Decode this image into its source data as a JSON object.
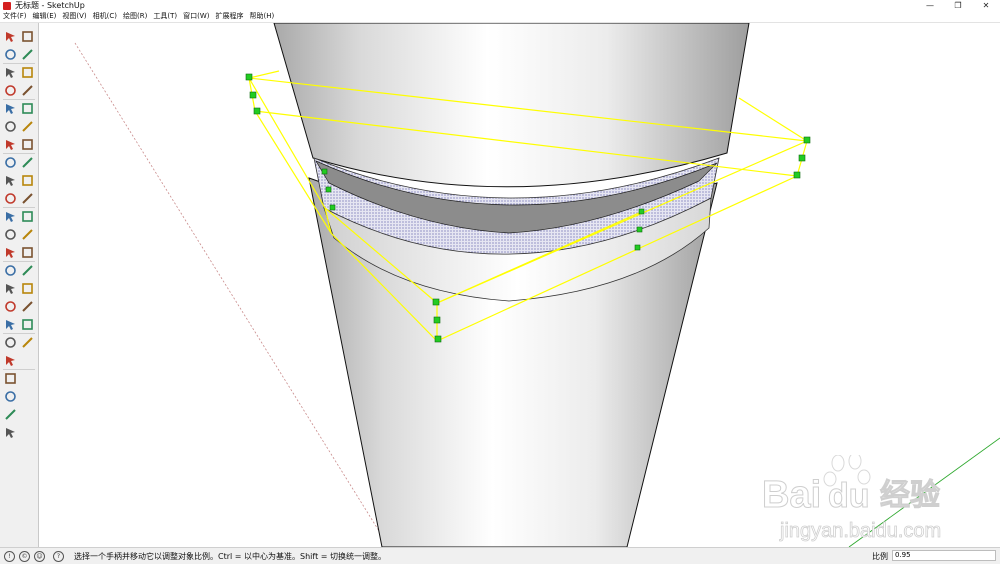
{
  "window": {
    "title": "无标题 - SketchUp",
    "minimize_icon": "minimize-icon",
    "maximize_icon": "restore-icon",
    "close_icon": "close-icon"
  },
  "menu": {
    "items": [
      "文件(F)",
      "编辑(E)",
      "视图(V)",
      "相机(C)",
      "绘图(R)",
      "工具(T)",
      "窗口(W)",
      "扩展程序",
      "帮助(H)"
    ]
  },
  "toolbar": {
    "tools": [
      "select-icon",
      "paint-bucket-icon",
      "eraser-icon",
      "pencil-line-icon",
      "freehand-icon",
      "rectangle-icon",
      "rotated-rectangle-icon",
      "circle-icon",
      "polygon-icon",
      "arc-icon",
      "pie-icon",
      "two-point-arc-icon",
      "three-point-arc-icon",
      "move-icon",
      "push-pull-icon",
      "rotate-icon",
      "follow-me-icon",
      "scale-icon",
      "offset-icon",
      "tape-measure-icon",
      "dimension-icon",
      "protractor-icon",
      "text-icon",
      "axes-icon",
      "3d-text-icon",
      "orbit-icon",
      "pan-icon",
      "zoom-icon",
      "zoom-window-icon",
      "zoom-extents-icon",
      "previous-view-icon",
      "position-camera-icon",
      "look-around-icon",
      "walk-icon",
      "section-plane-icon",
      "warehouse-icon",
      "extension-icon",
      "home-icon",
      "component-icon",
      "house-outline-icon",
      "layer-box-icon"
    ]
  },
  "status": {
    "icons": [
      "geo-location-icon",
      "credits-icon",
      "user-icon",
      "help-icon"
    ],
    "message": "选择一个手柄并移动它以调整对象比例。Ctrl = 以中心为基准。Shift = 切换统一调整。",
    "measure_label": "比例",
    "measure_value": "0.95"
  },
  "watermark": {
    "brand_left": "Bai",
    "brand_right": "经验",
    "url": "jingyan.baidu.com"
  },
  "colors": {
    "selection_box": "#ffff00",
    "handle": "#22cc22",
    "axis_red": "#c06060",
    "axis_green": "#2ea82e",
    "shape_edge": "#111111"
  }
}
